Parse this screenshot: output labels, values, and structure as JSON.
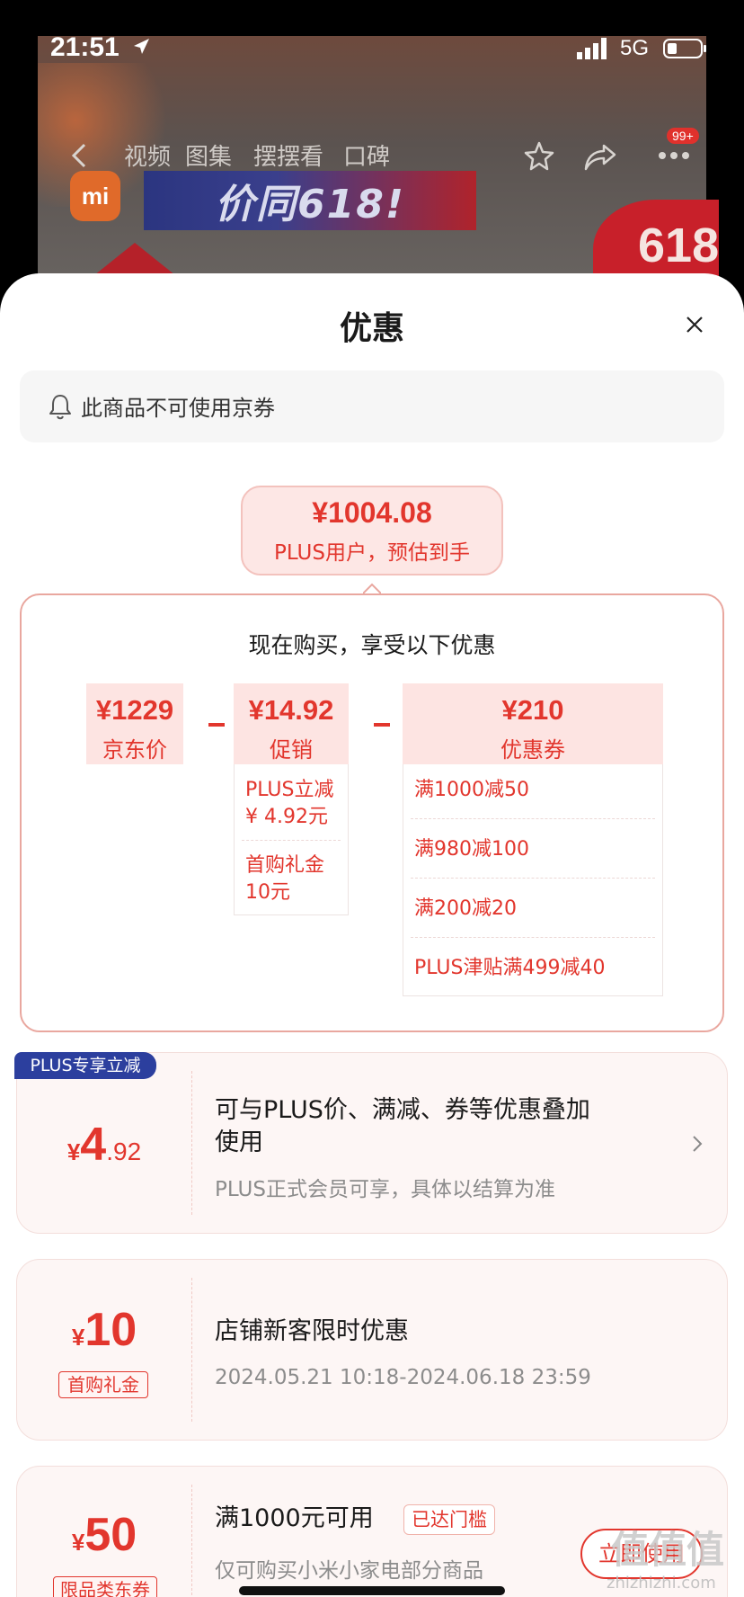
{
  "status_bar": {
    "time": "21:51",
    "network": "5G"
  },
  "top_nav": {
    "tabs": [
      "视频",
      "图集",
      "摆摆看",
      "口碑"
    ],
    "badge": "99+"
  },
  "background": {
    "brand_logo": "mi",
    "banner_text": "价同618!",
    "tag_text": "618"
  },
  "sheet": {
    "title": "优惠",
    "notice": "此商品不可使用京券",
    "estimate": {
      "price": "¥1004.08",
      "label": "PLUS用户，预估到手"
    },
    "calc": {
      "heading": "现在购买，享受以下优惠",
      "base": {
        "price": "¥1229",
        "label": "京东价"
      },
      "promo": {
        "price": "¥14.92",
        "label": "促销",
        "items": [
          {
            "line1": "PLUS立减",
            "line2": "¥ 4.92元"
          },
          {
            "line1": "首购礼金",
            "line2": "10元"
          }
        ]
      },
      "coupon": {
        "price": "¥210",
        "label": "优惠券",
        "items": [
          "满1000减50",
          "满980减100",
          "满200减20",
          "PLUS津贴满499减40"
        ]
      }
    },
    "cards": [
      {
        "tag": "PLUS专享立减",
        "currency": "¥",
        "amount_int": "4",
        "amount_dec": ".92",
        "title": "可与PLUS价、满减、券等优惠叠加使用",
        "title_line1": "可与PLUS价、满减、券等优惠叠加",
        "title_line2": "使用",
        "subtitle": "PLUS正式会员可享，具体以结算为准"
      },
      {
        "currency": "¥",
        "amount_int": "10",
        "label": "首购礼金",
        "title": "店铺新客限时优惠",
        "subtitle": "2024.05.21 10:18-2024.06.18 23:59"
      },
      {
        "currency": "¥",
        "amount_int": "50",
        "label": "限品类东券",
        "title": "满1000元可用",
        "badge": "已达门槛",
        "subtitle": "仅可购买小米小家电部分商品",
        "button": "立即使用"
      }
    ]
  },
  "watermark": {
    "logo": "值值值",
    "url": "zhizhizhi.com"
  },
  "colors": {
    "accent": "#e2362d",
    "plus_blue": "#2c3f9e",
    "card_bg": "#fdf6f5"
  }
}
